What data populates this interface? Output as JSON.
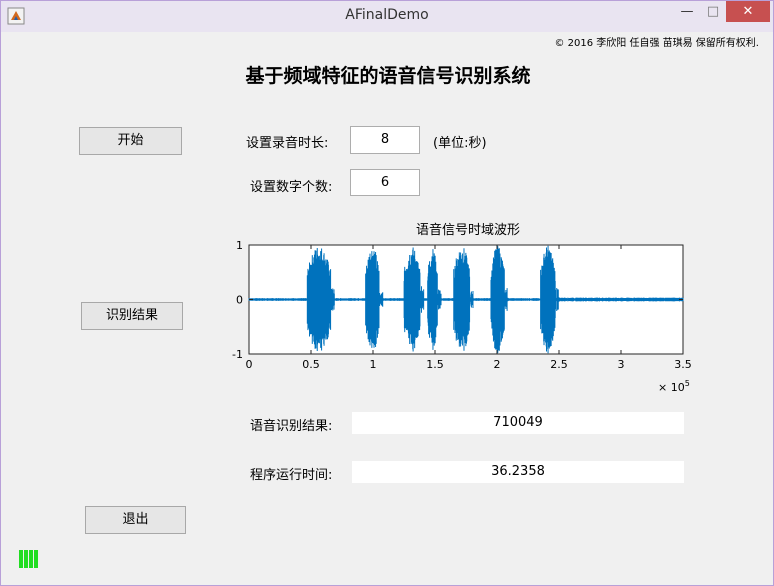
{
  "window": {
    "title": "AFinalDemo",
    "close_glyph": "✕",
    "min_glyph": "—",
    "max_glyph": "□",
    "accent": "#c75050"
  },
  "copyright": "© 2016 李欣阳 任自强 苗琪易 保留所有权利.",
  "heading": "基于频域特征的语音信号识别系统",
  "controls": {
    "start_label": "开始",
    "recognize_label": "识别结果",
    "exit_label": "退出",
    "duration_label": "设置录音时长:",
    "duration_value": "8",
    "duration_unit": "(单位:秒)",
    "digits_label": "设置数字个数:",
    "digits_value": "6",
    "result_label": "语音识别结果:",
    "result_value": "710049",
    "time_label": "程序运行时间:",
    "time_value": "36.2358"
  },
  "chart_data": {
    "type": "line",
    "title": "语音信号时域波形",
    "xlabel": "",
    "ylabel": "",
    "x_multiplier_label": "× 10",
    "x_multiplier_exp": "5",
    "xlim": [
      0,
      3.5
    ],
    "ylim": [
      -1,
      1
    ],
    "x_ticks": [
      "0",
      "0.5",
      "1",
      "1.5",
      "2",
      "2.5",
      "3",
      "3.5"
    ],
    "y_ticks": [
      "1",
      "0",
      "-1"
    ],
    "color": "#0072bd",
    "bursts": [
      {
        "start": 0.47,
        "end": 0.66,
        "amp": 1.0
      },
      {
        "start": 0.94,
        "end": 1.05,
        "amp": 1.0
      },
      {
        "start": 1.25,
        "end": 1.38,
        "amp": 0.98
      },
      {
        "start": 1.44,
        "end": 1.52,
        "amp": 0.95
      },
      {
        "start": 1.65,
        "end": 1.78,
        "amp": 1.0
      },
      {
        "start": 1.95,
        "end": 2.06,
        "amp": 1.0
      },
      {
        "start": 2.35,
        "end": 2.47,
        "amp": 1.0
      }
    ]
  }
}
